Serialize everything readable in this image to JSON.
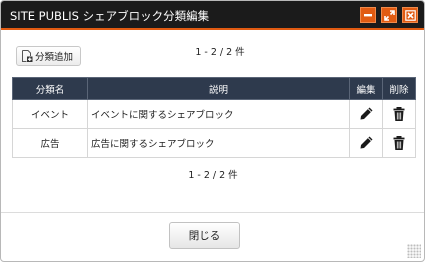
{
  "window": {
    "title": "SITE PUBLIS シェアブロック分類編集",
    "minimize_icon": "minimize-icon",
    "maximize_icon": "maximize-icon",
    "close_icon": "close-icon",
    "accent_color": "#e15b12",
    "titlebar_color": "#1b1b1b"
  },
  "toolbar": {
    "add_label": "分類追加",
    "add_icon": "add-document-icon"
  },
  "pager_top": "1 - 2 / 2 件",
  "pager_bottom": "1 - 2 / 2 件",
  "table": {
    "header_color": "#2e3a4d",
    "columns": {
      "name": "分類名",
      "description": "説明",
      "edit": "編集",
      "delete": "削除"
    },
    "rows": [
      {
        "name": "イベント",
        "description": "イベントに関するシェアブロック",
        "edit_icon": "pencil-icon",
        "delete_icon": "trash-icon"
      },
      {
        "name": "広告",
        "description": "広告に関するシェアブロック",
        "edit_icon": "pencil-icon",
        "delete_icon": "trash-icon"
      }
    ]
  },
  "footer": {
    "close_label": "閉じる"
  }
}
